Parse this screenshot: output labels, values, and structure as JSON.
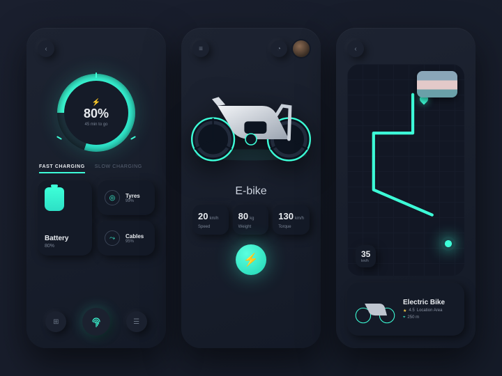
{
  "colors": {
    "accent": "#3dffd8",
    "bg": "#151b28"
  },
  "battery_screen": {
    "percent": "80%",
    "time_remaining": "45 min to go",
    "tabs": {
      "fast": "FAST CHARGING",
      "slow": "SLOW CHARGING"
    },
    "cards": {
      "battery": {
        "title": "Battery",
        "value": "80%"
      },
      "tyres": {
        "title": "Tyres",
        "value": "99%"
      },
      "cables": {
        "title": "Cables",
        "value": "95%"
      }
    }
  },
  "bike_screen": {
    "title": "E-bike",
    "stats": [
      {
        "value": "20",
        "unit": "km/h",
        "label": "Speed"
      },
      {
        "value": "80",
        "unit": "kg",
        "label": "Weight"
      },
      {
        "value": "130",
        "unit": "km/h",
        "label": "Torque"
      }
    ]
  },
  "map_screen": {
    "speed": {
      "value": "35",
      "unit": "km/h"
    },
    "card": {
      "title": "Electric Bike",
      "rating": "4.5",
      "area": "Location Area",
      "distance": "250 m"
    }
  }
}
